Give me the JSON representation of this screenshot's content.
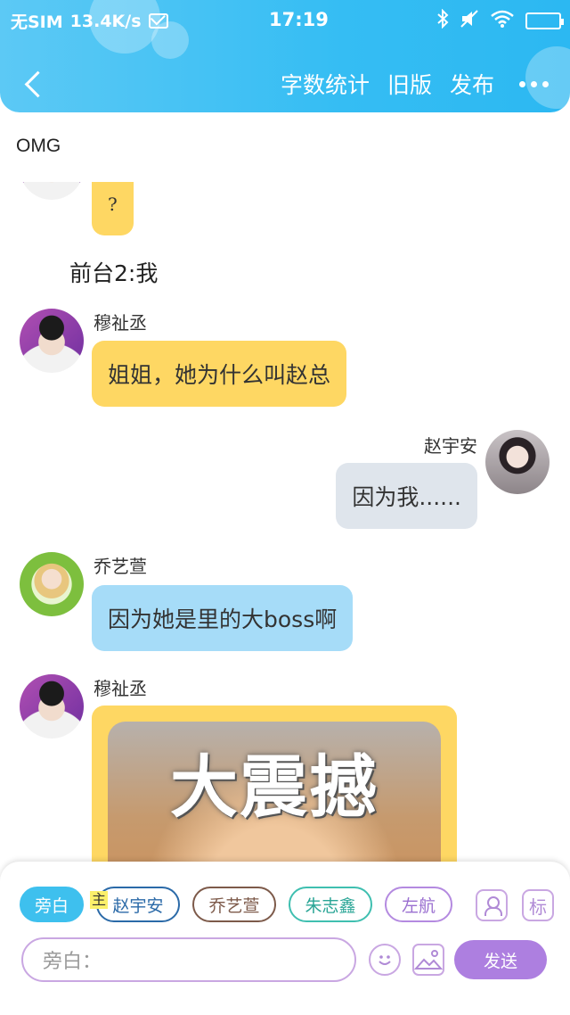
{
  "status_bar": {
    "carrier": "无SIM",
    "speed": "13.4K/s",
    "time": "17:19"
  },
  "nav": {
    "actions": [
      "字数统计",
      "旧版",
      "发布"
    ]
  },
  "title": "OMG",
  "chat": {
    "partial_bubble": "?",
    "narration": "前台2:我",
    "messages": [
      {
        "sender": "穆祉丞",
        "text": "姐姐，她为什么叫赵总"
      },
      {
        "sender": "赵宇安",
        "text": "因为我......"
      },
      {
        "sender": "乔艺萱",
        "text": "因为她是里的大boss啊"
      },
      {
        "sender": "穆祉丞",
        "image_text": "大震撼"
      }
    ]
  },
  "bottom_bar": {
    "narrator_chip": "旁白",
    "host_tag": "主",
    "characters": [
      "赵宇安",
      "乔艺萱",
      "朱志鑫",
      "左航"
    ],
    "tag_icon_label": "标",
    "input_placeholder": "旁白：",
    "send_label": "发送"
  },
  "colors": {
    "header": "#35bdf3",
    "yellow_bubble": "#fed763",
    "gray_bubble": "#dfe5ec",
    "blue_bubble": "#a6dcf8",
    "chip_active": "#3ec0ee",
    "send_button": "#ad7fe0",
    "accent_border": "#c9a7e2"
  }
}
